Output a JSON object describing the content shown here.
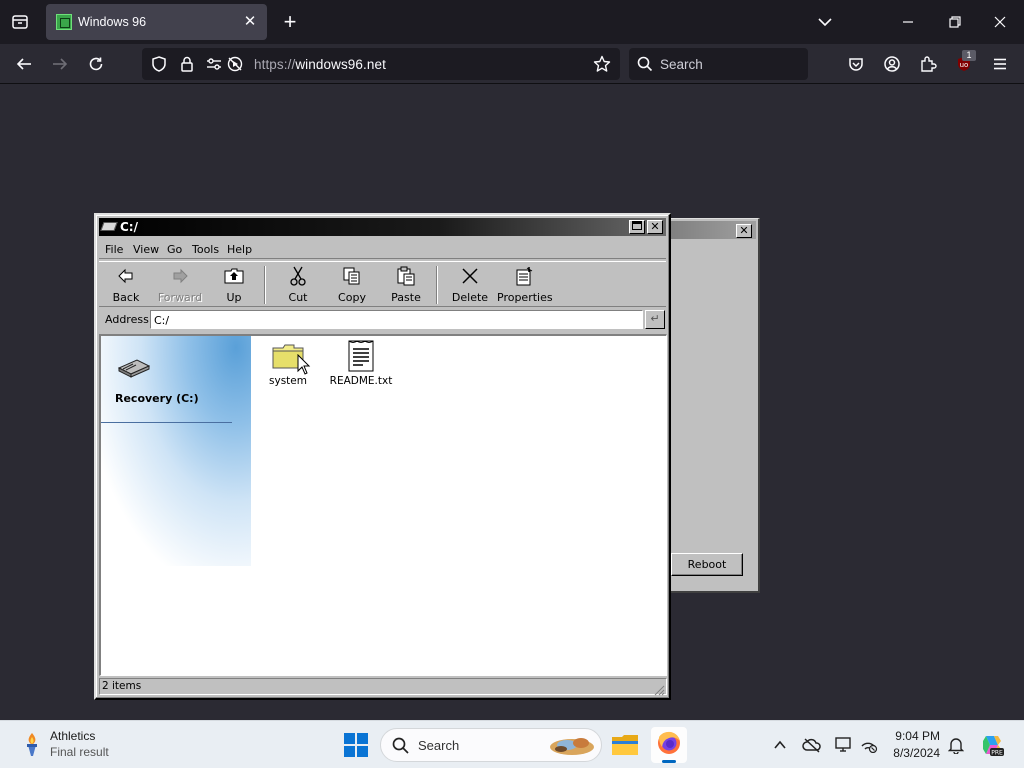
{
  "browser": {
    "tab": {
      "title": "Windows 96"
    },
    "url": {
      "scheme": "https://",
      "host": "windows96.net"
    },
    "search_placeholder": "Search",
    "extension_badge": "1"
  },
  "explorer": {
    "title": "C:/",
    "menu": [
      "File",
      "View",
      "Go",
      "Tools",
      "Help"
    ],
    "toolbar": {
      "back": "Back",
      "forward": "Forward",
      "up": "Up",
      "cut": "Cut",
      "copy": "Copy",
      "paste": "Paste",
      "delete": "Delete",
      "properties": "Properties"
    },
    "address_label": "Address",
    "address_value": "C:/",
    "sidebar_title": "Recovery (C:)",
    "files": [
      {
        "name": "system",
        "icon": "folder-icon"
      },
      {
        "name": "README.txt",
        "icon": "text-file-icon"
      }
    ],
    "status": "2 items"
  },
  "background_window": {
    "button_label": "Reboot"
  },
  "taskbar": {
    "widget_title": "Athletics",
    "widget_subtitle": "Final result",
    "search_placeholder": "Search",
    "time": "9:04 PM",
    "date": "8/3/2024"
  }
}
